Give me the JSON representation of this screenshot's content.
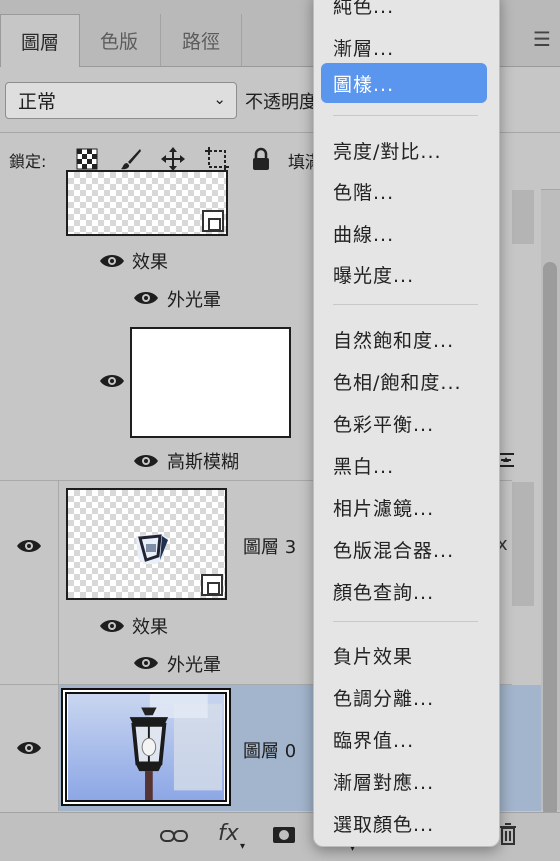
{
  "tabs": [
    "圖層",
    "色版",
    "路徑"
  ],
  "blend_mode": "正常",
  "opacity_label": "不透明度",
  "lock_label": "鎖定:",
  "fill_label": "填滿",
  "layers": {
    "effects_label_1": "效果",
    "outer_glow_1": "外光暈",
    "gaussian_blur": "高斯模糊",
    "layer3_name": "圖層 3",
    "effects_label_2": "效果",
    "outer_glow_2": "外光暈",
    "layer0_name": "圖層 0"
  },
  "menu": {
    "items": [
      "純色...",
      "漸層...",
      "圖樣...",
      "亮度/對比...",
      "色階...",
      "曲線...",
      "曝光度...",
      "自然飽和度...",
      "色相/飽和度...",
      "色彩平衡...",
      "黑白...",
      "相片濾鏡...",
      "色版混合器...",
      "顏色查詢...",
      "負片效果",
      "色調分離...",
      "臨界值...",
      "漸層對應...",
      "選取顏色..."
    ],
    "highlighted": "圖樣..."
  },
  "bottom": {
    "fx": "fx"
  },
  "colors": {
    "menu_highlight": "#5b96ee",
    "selected_layer": "#a3b5cc"
  }
}
